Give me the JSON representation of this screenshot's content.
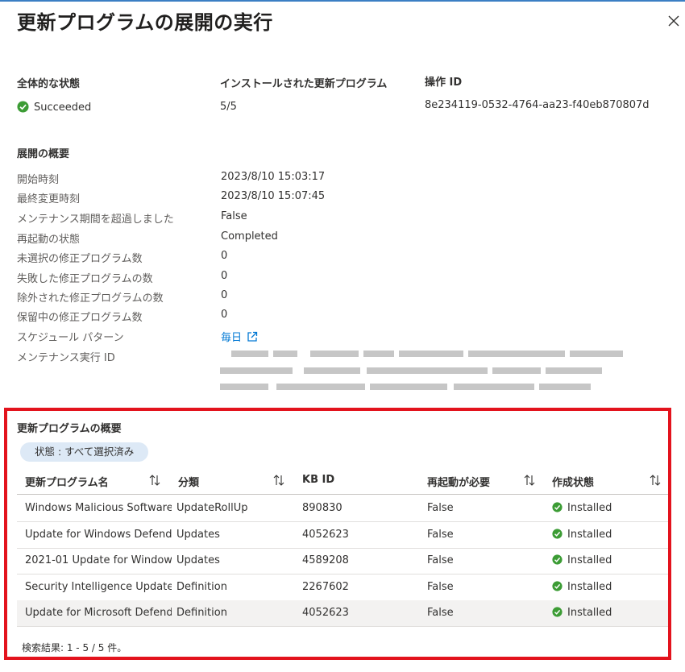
{
  "title": "更新プログラムの展開の実行",
  "overview": {
    "overall_status_label": "全体的な状態",
    "overall_status_value": "Succeeded",
    "installed_label": "インストールされた更新プログラム",
    "installed_value": "5/5",
    "operation_id_label": "操作 ID",
    "operation_id_value": "8e234119-0532-4764-aa23-f40eb870807d"
  },
  "deployment": {
    "title": "展開の概要",
    "rows": [
      {
        "label": "開始時刻",
        "value": "2023/8/10 15:03:17"
      },
      {
        "label": "最終変更時刻",
        "value": "2023/8/10 15:07:45"
      },
      {
        "label": "メンテナンス期間を超過しました",
        "value": "False"
      },
      {
        "label": "再起動の状態",
        "value": "Completed"
      },
      {
        "label": "未選択の修正プログラム数",
        "value": "0"
      },
      {
        "label": "失敗した修正プログラムの数",
        "value": "0"
      },
      {
        "label": "除外された修正プログラムの数",
        "value": "0"
      },
      {
        "label": "保留中の修正プログラム数",
        "value": "0"
      }
    ],
    "schedule_label": "スケジュール パターン",
    "schedule_value": "毎日",
    "maintenance_id_label": "メンテナンス実行 ID"
  },
  "updates": {
    "title": "更新プログラムの概要",
    "filter_pill": "状態 : すべて選択済み",
    "columns": [
      "更新プログラム名",
      "分類",
      "KB ID",
      "再起動が必要",
      "作成状態"
    ],
    "rows": [
      {
        "name": "Windows Malicious Software...",
        "classification": "UpdateRollUp",
        "kb": "890830",
        "reboot": "False",
        "state": "Installed"
      },
      {
        "name": "Update for Windows Defend...",
        "classification": "Updates",
        "kb": "4052623",
        "reboot": "False",
        "state": "Installed"
      },
      {
        "name": "2021-01 Update for Window...",
        "classification": "Updates",
        "kb": "4589208",
        "reboot": "False",
        "state": "Installed"
      },
      {
        "name": "Security Intelligence Update ...",
        "classification": "Definition",
        "kb": "2267602",
        "reboot": "False",
        "state": "Installed"
      },
      {
        "name": "Update for Microsoft Defend...",
        "classification": "Definition",
        "kb": "4052623",
        "reboot": "False",
        "state": "Installed"
      }
    ],
    "footer": "検索結果: 1 - 5 / 5 件。"
  },
  "colors": {
    "success": "#3c9c35",
    "link": "#0078d4",
    "highlight_box": "#e3131d"
  }
}
